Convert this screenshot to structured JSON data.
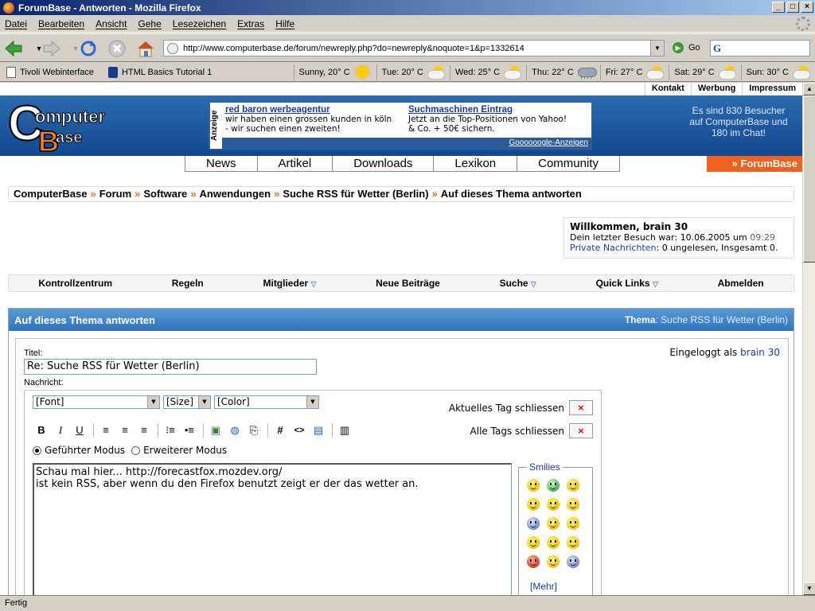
{
  "window": {
    "title": "ForumBase - Antworten - Mozilla Firefox",
    "controls": [
      "_",
      "□",
      "×"
    ]
  },
  "menubar": {
    "items": [
      "Datei",
      "Bearbeiten",
      "Ansicht",
      "Gehe",
      "Lesezeichen",
      "Extras",
      "Hilfe"
    ]
  },
  "navbar": {
    "url": "http://www.computerbase.de/forum/newreply.php?do=newreply&noquote=1&p=1332614",
    "go_label": "Go",
    "search_logo": "G"
  },
  "bookmarks": {
    "items": [
      "Tivoli Webinterface",
      "HTML Basics Tutorial 1"
    ],
    "weather": [
      {
        "label": "Sunny, 20° C",
        "icon": "sun-icon"
      },
      {
        "label": "Tue: 20° C",
        "icon": "cloud-icon"
      },
      {
        "label": "Wed: 25° C",
        "icon": "cloud-icon"
      },
      {
        "label": "Thu: 22° C",
        "icon": "rain-icon"
      },
      {
        "label": "Fri: 27° C",
        "icon": "cloud-icon"
      },
      {
        "label": "Sat: 29° C",
        "icon": "cloud-icon"
      },
      {
        "label": "Sun: 30° C",
        "icon": "cloud-icon"
      }
    ]
  },
  "site": {
    "toplinks": [
      "Kontakt",
      "Werbung",
      "Impressum"
    ],
    "logo": {
      "c": "C",
      "omputer": "omputer",
      "b": "B",
      "ase": "ase"
    },
    "ad": {
      "label": "Anzeige",
      "ad1_title": "red baron werbeagentur",
      "ad1_line1": "wir haben einen grossen kunden in köln",
      "ad1_line2": "- wir suchen einen zweiten!",
      "ad2_title": "Suchmaschinen Eintrag",
      "ad2_line1": "Jetzt an die Top-Positionen von Yahoo!",
      "ad2_line2": "& Co. + 50€ sichern.",
      "footer": "Goooooogle-Anzeigen"
    },
    "visitors_line1": "Es sind 830 Besucher",
    "visitors_line2": "auf ComputerBase und",
    "visitors_line3": "180 im Chat!",
    "mainnav": [
      "News",
      "Artikel",
      "Downloads",
      "Lexikon",
      "Community"
    ],
    "forum_tab": "» ForumBase"
  },
  "breadcrumb": {
    "items": [
      "ComputerBase",
      "Forum",
      "Software",
      "Anwendungen",
      "Suche RSS für Wetter (Berlin)",
      "Auf dieses Thema antworten"
    ],
    "separator": "»"
  },
  "welcome": {
    "title": "Willkommen, brain 30",
    "last_visit_prefix": "Dein letzter Besuch war: 10.06.2005 um",
    "last_visit_time": "09:29",
    "pm_link": "Private Nachrichten",
    "pm_text": ": 0 ungelesen, Insgesamt 0."
  },
  "forumnav": {
    "items": [
      "Kontrollzentrum",
      "Regeln",
      "Mitglieder",
      "Neue Beiträge",
      "Suche",
      "Quick Links",
      "Abmelden"
    ],
    "dropdown_marker": "▽"
  },
  "reply": {
    "panel_title": "Auf dieses Thema antworten",
    "thema_label": "Thema",
    "thema_value": ": Suche RSS für Wetter (Berlin)",
    "title_label": "Titel:",
    "title_value": "Re: Suche RSS für Wetter (Berlin)",
    "message_label": "Nachricht:",
    "logged_in_prefix": "Eingeloggt als",
    "logged_in_user": "brain 30",
    "font_select": "[Font]",
    "size_select": "[Size]",
    "color_select": "[Color]",
    "close_current_tag": "Aktuelles Tag schliessen",
    "close_all_tags": "Alle Tags schliessen",
    "close_x": "×",
    "toolbar": [
      "B",
      "I",
      "U",
      "≡",
      "≡",
      "≡",
      "⁝≡",
      "•≡",
      "▣",
      "◍",
      "⎘",
      "#",
      "<>",
      "▤",
      "▥"
    ],
    "mode_guided": "Geführter Modus",
    "mode_advanced": "Erweiterer Modus",
    "message": "Schau mal hier... http://forecastfox.mozdev.org/\nist kein RSS, aber wenn du den Firefox benutzt zeigt er der das wetter an.",
    "smilies_label": "Smilies",
    "smilies_more": "[Mehr]"
  },
  "statusbar": {
    "text": "Fertig"
  }
}
